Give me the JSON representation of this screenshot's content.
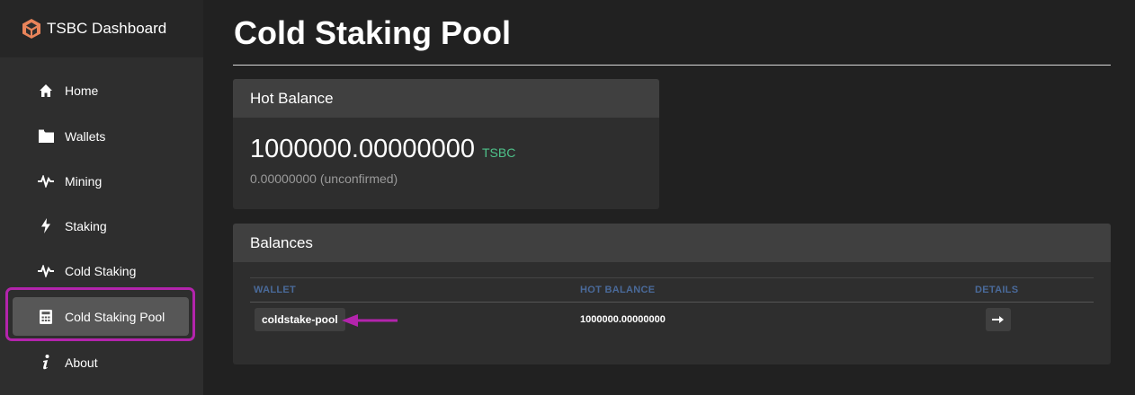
{
  "app": {
    "title": "TSBC Dashboard"
  },
  "sidebar": {
    "items": [
      {
        "label": "Home",
        "icon": "home-icon"
      },
      {
        "label": "Wallets",
        "icon": "folder-icon"
      },
      {
        "label": "Mining",
        "icon": "pulse-icon"
      },
      {
        "label": "Staking",
        "icon": "bolt-icon"
      },
      {
        "label": "Cold Staking",
        "icon": "pulse-icon"
      },
      {
        "label": "Cold Staking Pool",
        "icon": "calculator-icon",
        "active": true
      },
      {
        "label": "About",
        "icon": "info-icon"
      }
    ]
  },
  "page": {
    "title": "Cold Staking Pool"
  },
  "hot_balance": {
    "header": "Hot Balance",
    "amount": "1000000.00000000",
    "unit": "TSBC",
    "unconfirmed": "0.00000000 (unconfirmed)"
  },
  "balances": {
    "header": "Balances",
    "columns": [
      "WALLET",
      "HOT BALANCE",
      "DETAILS"
    ],
    "rows": [
      {
        "wallet": "coldstake-pool",
        "hot_balance": "1000000.00000000"
      }
    ]
  },
  "colors": {
    "accent_green": "#4ec28a",
    "highlight_purple": "#b324ac",
    "column_header_blue": "#4a6a9a"
  }
}
